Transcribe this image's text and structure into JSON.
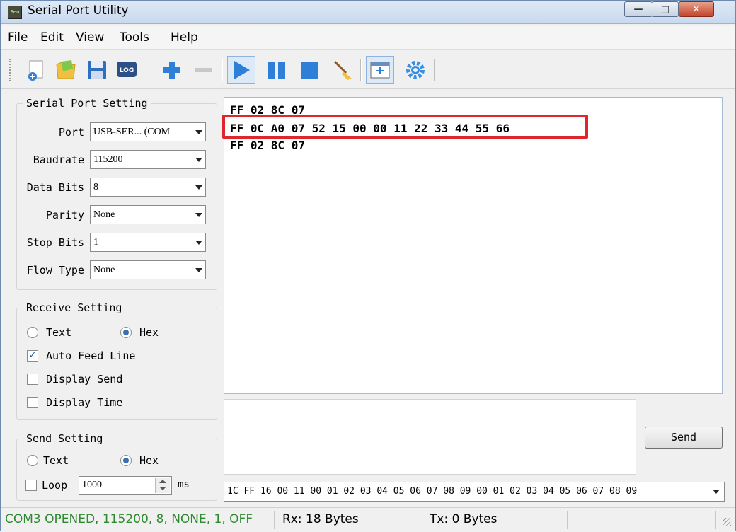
{
  "window": {
    "title": "Serial Port Utility",
    "icon_text": "Seu"
  },
  "menu": [
    "File",
    "Edit",
    "View",
    "Tools",
    "Help"
  ],
  "toolbar": {
    "icons": [
      "new-file-icon",
      "open-folder-icon",
      "save-icon",
      "log-icon",
      "plus-icon",
      "minus-icon",
      "play-icon",
      "pause-icon",
      "stop-icon",
      "clear-broom-icon",
      "add-window-icon",
      "settings-gear-icon"
    ],
    "log_label": "LOG"
  },
  "serial_port_setting": {
    "title": "Serial Port Setting",
    "port": {
      "label": "Port",
      "value": "USB-SER... (COM"
    },
    "baudrate": {
      "label": "Baudrate",
      "value": "115200"
    },
    "data_bits": {
      "label": "Data Bits",
      "value": "8"
    },
    "parity": {
      "label": "Parity",
      "value": "None"
    },
    "stop_bits": {
      "label": "Stop Bits",
      "value": "1"
    },
    "flow_type": {
      "label": "Flow Type",
      "value": "None"
    }
  },
  "receive_setting": {
    "title": "Receive Setting",
    "text_label": "Text",
    "hex_label": "Hex",
    "auto_feed_line": "Auto Feed Line",
    "display_send": "Display Send",
    "display_time": "Display Time"
  },
  "send_setting": {
    "title": "Send Setting",
    "text_label": "Text",
    "hex_label": "Hex",
    "loop_label": "Loop",
    "loop_value": "1000",
    "unit": "ms"
  },
  "receive_data": {
    "lines": [
      "FF 02 8C 07",
      "FF 0C A0 07 52 15 00 00 11 22 33 44 55 66",
      "FF 02 8C 07"
    ]
  },
  "send_button": "Send",
  "send_history": "1C FF 16 00 11 00 01 02 03 04 05 06 07 08 09 00 01 02 03 04 05 06 07 08 09",
  "status": {
    "connection": "COM3 OPENED, 115200, 8, NONE, 1, OFF",
    "rx": "Rx: 18 Bytes",
    "tx": "Tx: 0 Bytes"
  },
  "colors": {
    "highlight": "#e0262d",
    "accent_blue": "#2d7fd8"
  }
}
